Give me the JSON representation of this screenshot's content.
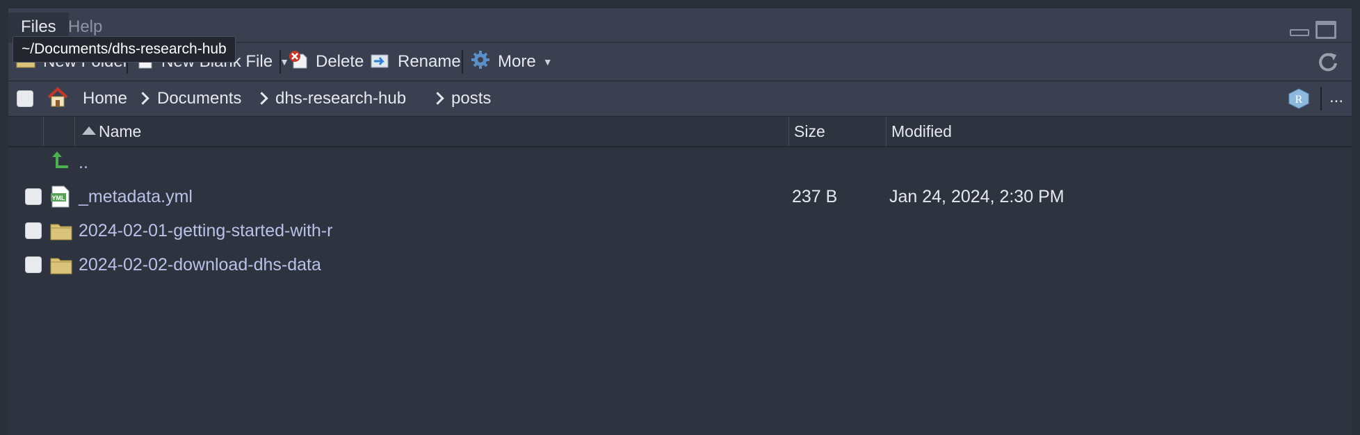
{
  "tabs": [
    {
      "label": "Files"
    },
    {
      "label": "Help"
    }
  ],
  "tooltip": "~/Documents/dhs-research-hub",
  "toolbar": {
    "new_folder": "New Folder",
    "new_blank_file": "New Blank File",
    "delete": "Delete",
    "rename": "Rename",
    "more": "More"
  },
  "breadcrumb": [
    "Home",
    "Documents",
    "dhs-research-hub",
    "posts"
  ],
  "breadcrumb_more": "...",
  "columns": {
    "name": "Name",
    "size": "Size",
    "modified": "Modified"
  },
  "rows": [
    {
      "name": "..",
      "size": "",
      "modified": "",
      "type": "parent-dir"
    },
    {
      "name": "_metadata.yml",
      "size": "237 B",
      "modified": "Jan 24, 2024, 2:30 PM",
      "type": "yml-file"
    },
    {
      "name": "2024-02-01-getting-started-with-r",
      "size": "",
      "modified": "",
      "type": "folder"
    },
    {
      "name": "2024-02-02-download-dhs-data",
      "size": "",
      "modified": "",
      "type": "folder"
    }
  ],
  "icons": {
    "home": "home-icon",
    "new_folder": "new-folder-icon",
    "new_file": "new-file-icon",
    "delete": "delete-icon",
    "rename": "rename-icon",
    "more": "gear-icon",
    "refresh": "refresh-icon",
    "project": "r-project-icon"
  },
  "colors": {
    "background": "#2e3340",
    "toolbar": "#3b4051",
    "link": "#b9c2e6",
    "folder": "#d9c27a",
    "yml": "#5aa05a",
    "home_roof": "#c0392b"
  }
}
